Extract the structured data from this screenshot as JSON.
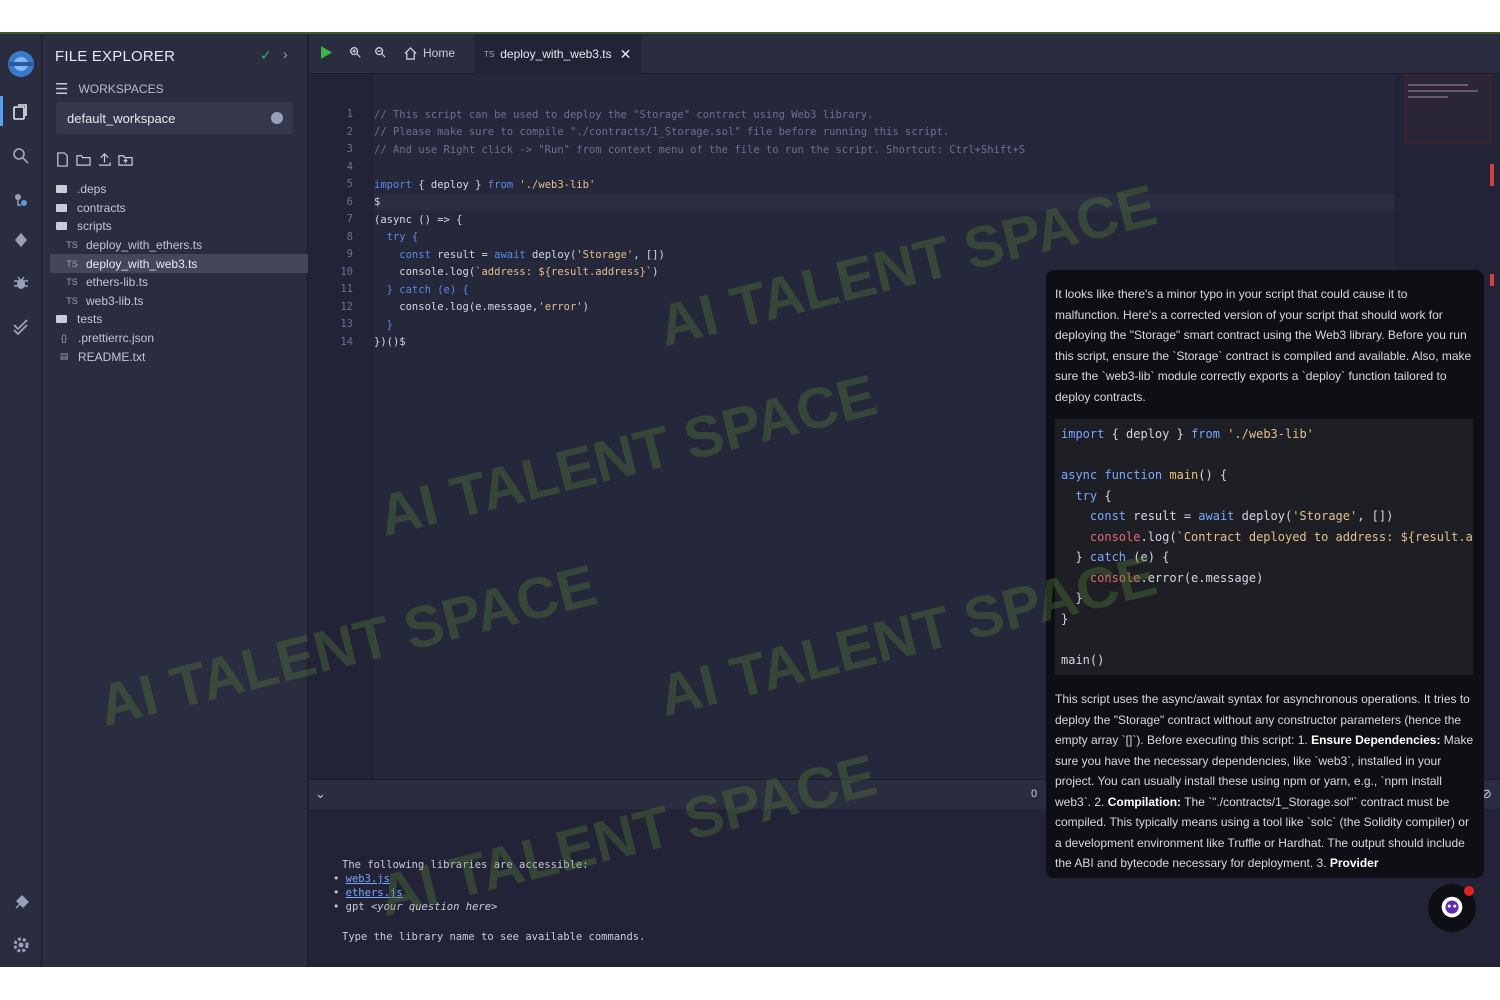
{
  "rail": {
    "icons": [
      "logo-icon",
      "file-explorer-icon",
      "search-icon",
      "plugin-icon",
      "compile-icon",
      "debug-icon",
      "verify-icon",
      "plug-icon",
      "settings-icon"
    ]
  },
  "explorer": {
    "title": "FILE EXPLORER",
    "workspaces_label": "WORKSPACES",
    "workspace_value": "default_workspace",
    "tree": [
      {
        "label": ".deps",
        "type": "folder",
        "depth": 0
      },
      {
        "label": "contracts",
        "type": "folder",
        "depth": 0
      },
      {
        "label": "scripts",
        "type": "folder-open",
        "depth": 0
      },
      {
        "label": "deploy_with_ethers.ts",
        "type": "ts",
        "depth": 1
      },
      {
        "label": "deploy_with_web3.ts",
        "type": "ts",
        "depth": 1,
        "selected": true
      },
      {
        "label": "ethers-lib.ts",
        "type": "ts",
        "depth": 1
      },
      {
        "label": "web3-lib.ts",
        "type": "ts",
        "depth": 1
      },
      {
        "label": "tests",
        "type": "folder",
        "depth": 0
      },
      {
        "label": ".prettierrc.json",
        "type": "json",
        "depth": 0
      },
      {
        "label": "README.txt",
        "type": "txt",
        "depth": 0
      }
    ]
  },
  "tabs": {
    "home_label": "Home",
    "active_label": "deploy_with_web3.ts",
    "ts_badge": "TS"
  },
  "editor": {
    "lines": [
      {
        "n": "1",
        "parts": [
          {
            "t": "// This script can be used to deploy the \"Storage\" contract using Web3 library.",
            "c": "comment"
          }
        ]
      },
      {
        "n": "2",
        "parts": [
          {
            "t": "// Please make sure to compile \"./contracts/1_Storage.sol\" file before running this script.",
            "c": "comment"
          }
        ]
      },
      {
        "n": "3",
        "parts": [
          {
            "t": "// And use Right click -> \"Run\" from context menu of the file to run the script. Shortcut: Ctrl+Shift+S",
            "c": "comment"
          }
        ]
      },
      {
        "n": "4",
        "parts": []
      },
      {
        "n": "5",
        "parts": [
          {
            "t": "import",
            "c": "kw"
          },
          {
            "t": " { deploy } ",
            "c": "plain"
          },
          {
            "t": "from",
            "c": "kw"
          },
          {
            "t": " './web3-lib'",
            "c": "str"
          }
        ]
      },
      {
        "n": "6",
        "parts": [
          {
            "t": "$",
            "c": "plain"
          }
        ],
        "highlight": true
      },
      {
        "n": "7",
        "parts": [
          {
            "t": "(async () => {",
            "c": "plain"
          }
        ]
      },
      {
        "n": "8",
        "parts": [
          {
            "t": "  try {",
            "c": "kw"
          }
        ]
      },
      {
        "n": "9",
        "parts": [
          {
            "t": "    const",
            "c": "kw"
          },
          {
            "t": " result = ",
            "c": "plain"
          },
          {
            "t": "await",
            "c": "kw"
          },
          {
            "t": " deploy(",
            "c": "plain"
          },
          {
            "t": "'Storage'",
            "c": "str"
          },
          {
            "t": ", [])",
            "c": "plain"
          }
        ]
      },
      {
        "n": "10",
        "parts": [
          {
            "t": "    console.log(",
            "c": "plain"
          },
          {
            "t": "`address: ${result.address}`",
            "c": "str"
          },
          {
            "t": ")",
            "c": "plain"
          }
        ]
      },
      {
        "n": "11",
        "parts": [
          {
            "t": "  } catch (e) {",
            "c": "kw"
          }
        ]
      },
      {
        "n": "12",
        "parts": [
          {
            "t": "    console.log(e.message,",
            "c": "plain"
          },
          {
            "t": "'error'",
            "c": "str"
          },
          {
            "t": ")",
            "c": "plain"
          }
        ]
      },
      {
        "n": "13",
        "parts": [
          {
            "t": "  }",
            "c": "kw"
          }
        ]
      },
      {
        "n": "14",
        "parts": [
          {
            "t": "})()$",
            "c": "plain"
          }
        ]
      }
    ]
  },
  "terminal": {
    "counter": "0",
    "intro": "The following libraries are accessible:",
    "libs": [
      "web3.js",
      "ethers.js"
    ],
    "gpt_prefix": "gpt ",
    "gpt_hint": "<your question here>",
    "hint": "Type the library name to see available commands.",
    "prompt": ">"
  },
  "chat": {
    "intro": "It looks like there's a minor typo in your script that could cause it to malfunction. Here's a corrected version of your script that should work for deploying the \"Storage\" smart contract using the Web3 library. Before you run this script, ensure the `Storage` contract is compiled and available. Also, make sure the `web3-lib` module correctly exports a `deploy` function tailored to deploy contracts.",
    "code": [
      [
        {
          "t": "import",
          "c": "kw"
        },
        {
          "t": " { deploy } ",
          "c": "plain"
        },
        {
          "t": "from",
          "c": "kw"
        },
        {
          "t": " './web3-lib'",
          "c": "str"
        }
      ],
      [],
      [
        {
          "t": "async function",
          "c": "kw"
        },
        {
          "t": " main",
          "c": "fn"
        },
        {
          "t": "() {",
          "c": "plain"
        }
      ],
      [
        {
          "t": "  try",
          "c": "kw"
        },
        {
          "t": " {",
          "c": "plain"
        }
      ],
      [
        {
          "t": "    const",
          "c": "kw"
        },
        {
          "t": " result = ",
          "c": "plain"
        },
        {
          "t": "await",
          "c": "kw"
        },
        {
          "t": " deploy(",
          "c": "plain"
        },
        {
          "t": "'Storage'",
          "c": "str"
        },
        {
          "t": ", [])",
          "c": "plain"
        }
      ],
      [
        {
          "t": "    console",
          "c": "red"
        },
        {
          "t": ".log(",
          "c": "plain"
        },
        {
          "t": "`Contract deployed to address: ${result.address}`",
          "c": "str"
        },
        {
          "t": ")",
          "c": "plain"
        }
      ],
      [
        {
          "t": "  } ",
          "c": "plain"
        },
        {
          "t": "catch",
          "c": "kw"
        },
        {
          "t": " (e) {",
          "c": "plain"
        }
      ],
      [
        {
          "t": "    console",
          "c": "red"
        },
        {
          "t": ".error(e.message)",
          "c": "plain"
        }
      ],
      [
        {
          "t": "  }",
          "c": "plain"
        }
      ],
      [
        {
          "t": "}",
          "c": "plain"
        }
      ],
      [],
      [
        {
          "t": "main()",
          "c": "plain"
        }
      ]
    ],
    "outro_parts": [
      {
        "t": "This script uses the async/await syntax for asynchronous operations. It tries to deploy the \"Storage\" contract without any constructor parameters (hence the empty array `[]`). Before executing this script: 1. ",
        "b": false
      },
      {
        "t": "Ensure Dependencies:",
        "b": true
      },
      {
        "t": " Make sure you have the necessary dependencies, like `web3`, installed in your project. You can usually install these using npm or yarn, e.g., `npm install web3`. 2. ",
        "b": false
      },
      {
        "t": "Compilation:",
        "b": true
      },
      {
        "t": " The `\"./contracts/1_Storage.sol\"` contract must be compiled. This typically means using a tool like `solc` (the Solidity compiler) or a development environment like Truffle or Hardhat. The output should include the ABI and bytecode necessary for deployment. 3. ",
        "b": false
      },
      {
        "t": "Provider",
        "b": true
      }
    ]
  },
  "watermark": "AI TALENT SPACE",
  "colors": {
    "bg": "#222336",
    "panel": "#2a2c3f",
    "keyword": "#5d87e6",
    "string": "#e2c08d",
    "comment": "#6b7090",
    "accent_green": "#3fb34f",
    "chat_bg": "#0e0f14"
  }
}
